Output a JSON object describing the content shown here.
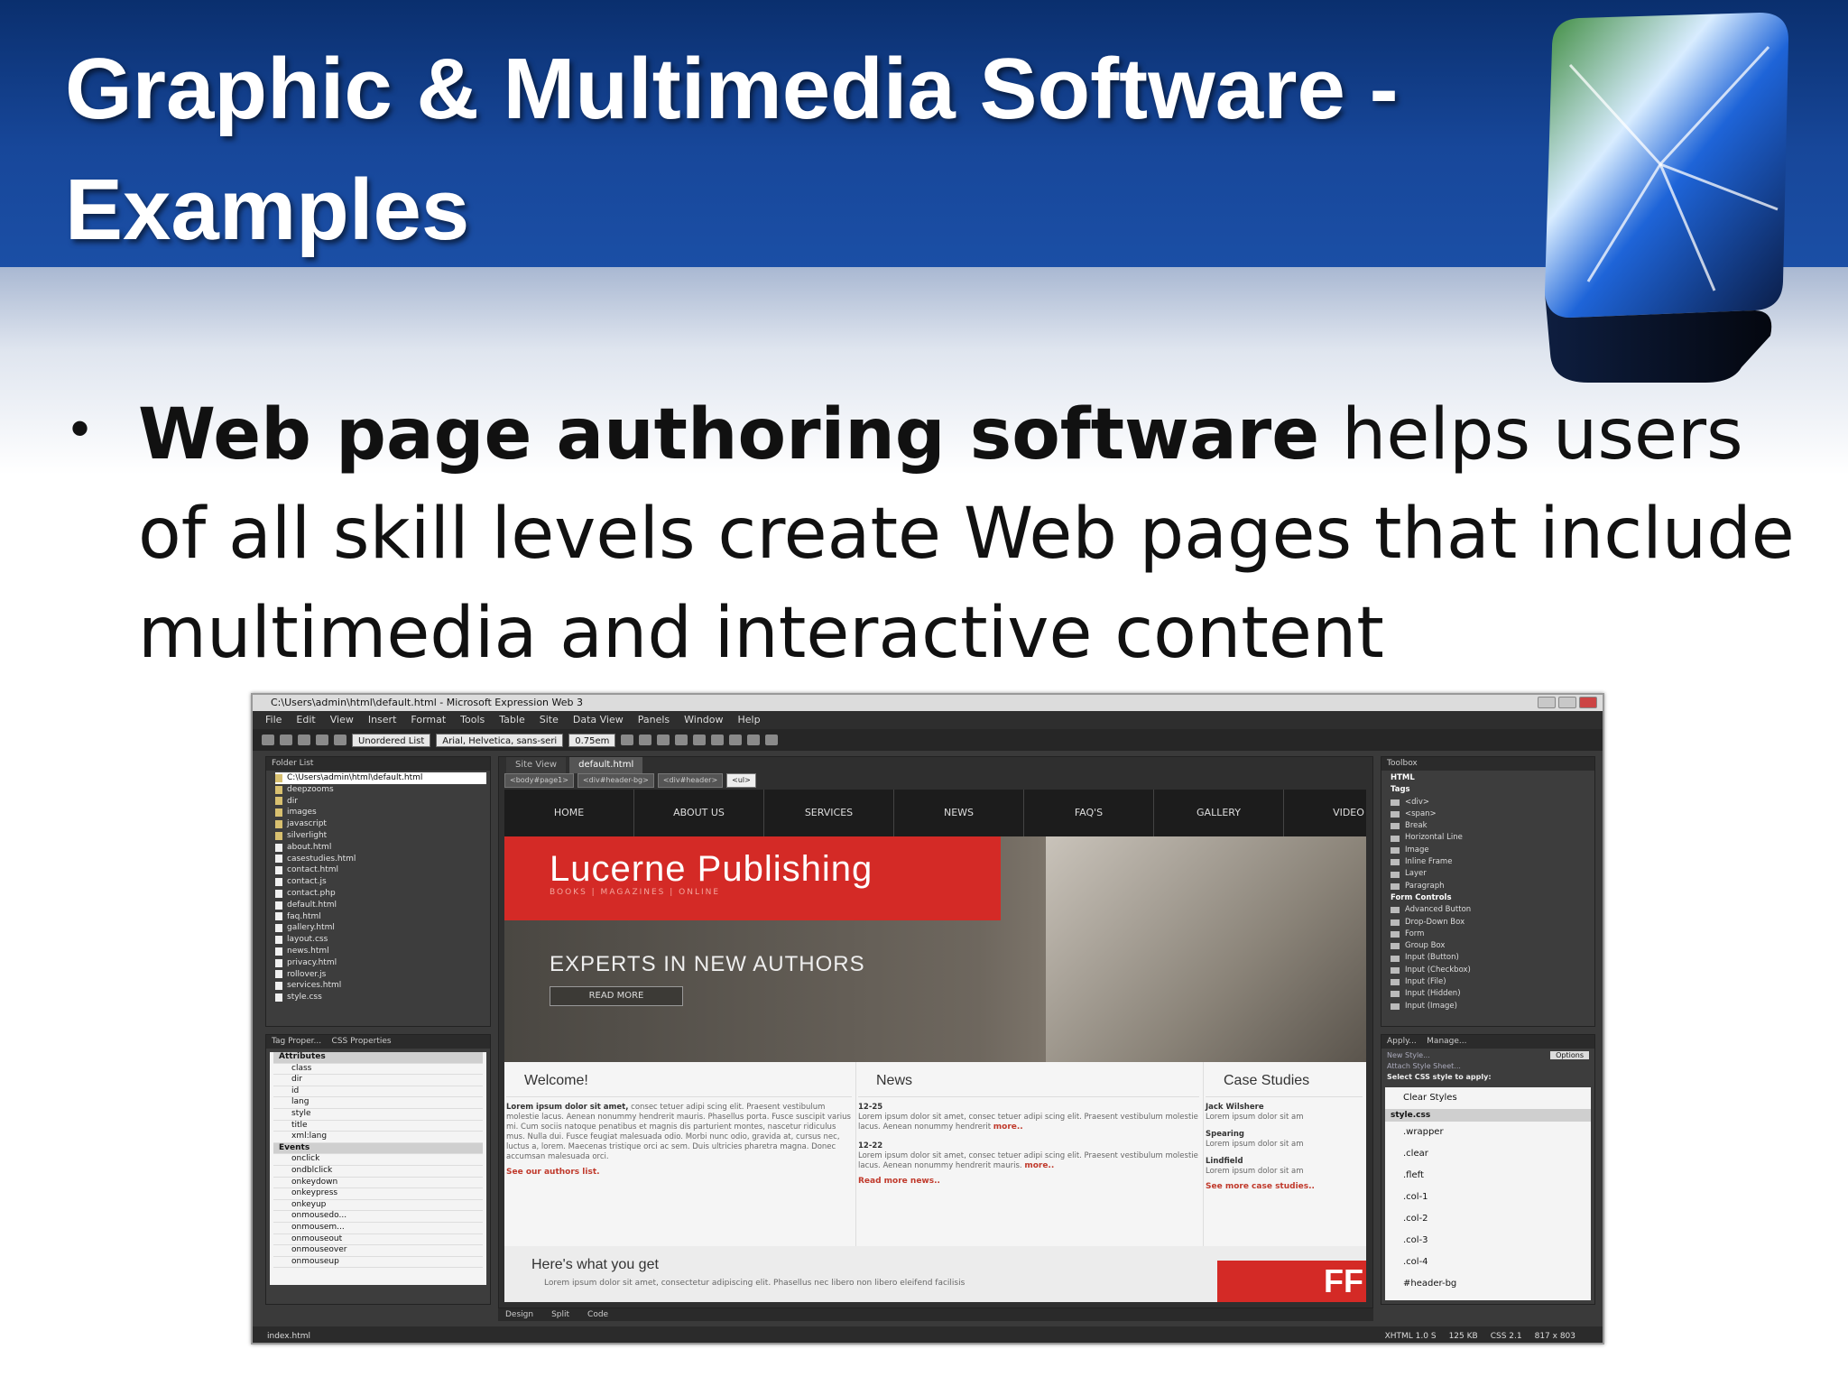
{
  "slide": {
    "title_line1": "Graphic & Multimedia Software -",
    "title_line2": "Examples",
    "bullet_bold": "Web page authoring software",
    "bullet_rest": " helps users of all skill levels create Web pages that include multimedia and interactive content"
  },
  "screenshot": {
    "window_title": "C:\\Users\\admin\\html\\default.html - Microsoft Expression Web 3",
    "menu": [
      "File",
      "Edit",
      "View",
      "Insert",
      "Format",
      "Tools",
      "Table",
      "Site",
      "Data View",
      "Panels",
      "Window",
      "Help"
    ],
    "toolbar": {
      "style_select": "Unordered List",
      "font_select": "Arial, Helvetica, sans-seri",
      "size_select": "0.75em"
    },
    "folder_panel": {
      "title": "Folder List",
      "items": [
        "C:\\Users\\admin\\html\\default.html",
        "deepzooms",
        "dir",
        "images",
        "javascript",
        "silverlight",
        "about.html",
        "casestudies.html",
        "contact.html",
        "contact.js",
        "contact.php",
        "default.html",
        "faq.html",
        "gallery.html",
        "layout.css",
        "news.html",
        "privacy.html",
        "rollover.js",
        "services.html",
        "style.css"
      ]
    },
    "tag_panel": {
      "title": "Tag Proper...",
      "title2": "CSS Properties",
      "items": [
        "Attributes",
        "class",
        "dir",
        "id",
        "lang",
        "style",
        "title",
        "xml:lang",
        "Events",
        "onclick",
        "ondblclick",
        "onkeydown",
        "onkeypress",
        "onkeyup",
        "onmousedo...",
        "onmousem...",
        "onmouseout",
        "onmouseover",
        "onmouseup"
      ]
    },
    "editor": {
      "tabs": [
        "Site View",
        "default.html"
      ],
      "breadcrumb": [
        "<body#page1>",
        "<div#header-bg>",
        "<div#header>",
        "<ul>"
      ],
      "nav": [
        "HOME",
        "ABOUT US",
        "SERVICES",
        "NEWS",
        "FAQ'S",
        "GALLERY",
        "VIDEO"
      ],
      "hero_title": "Lucerne Publishing",
      "hero_sub": "BOOKS | MAGAZINES | ONLINE",
      "hero_tagline": "EXPERTS IN NEW AUTHORS",
      "hero_button": "READ MORE",
      "col1_head": "Welcome!",
      "col1_lead": "Lorem ipsum dolor sit amet,",
      "col1_text": " consec tetuer adipi scing elit. Praesent vestibulum molestie lacus. Aenean nonummy hendrerit mauris. Phasellus porta. Fusce suscipit varius mi. Cum sociis natoque penatibus et magnis dis parturient montes, nascetur ridiculus mus. Nulla dui. Fusce feugiat malesuada odio. Morbi nunc odio, gravida at, cursus nec, luctus a, lorem. Maecenas tristique orci ac sem. Duis ultricies pharetra magna. Donec accumsan malesuada orci.",
      "col1_link": "See our authors list.",
      "col2_head": "News",
      "news1_date": "12-25",
      "news1_text": "Lorem ipsum dolor sit amet, consec tetuer adipi scing elit. Praesent vestibulum molestie lacus. Aenean nonummy hendrerit",
      "news1_more": "more..",
      "news2_date": "12-22",
      "news2_text": "Lorem ipsum dolor sit amet, consec tetuer adipi scing elit. Praesent vestibulum molestie lacus. Aenean nonummy hendrerit mauris.",
      "news2_more": "more..",
      "col2_link": "Read more news..",
      "col3_head": "Case Studies",
      "case1_name": "Jack Wilshere",
      "case1_text": "Lorem ipsum dolor sit am",
      "case2_name": "Spearing",
      "case2_text": "Lorem ipsum dolor sit am",
      "case3_name": "Lindfield",
      "case3_text": "Lorem ipsum dolor sit am",
      "col3_link": "See more case studies..",
      "what_head": "Here's what you get",
      "what_text": "Lorem ipsum dolor sit amet, consectetur adipiscing elit. Phasellus nec libero non libero eleifend facilisis",
      "ff_text": "FF",
      "views": [
        "Design",
        "Split",
        "Code"
      ]
    },
    "toolbox_panel": {
      "title": "Toolbox",
      "items": [
        "HTML",
        "Tags",
        "<div>",
        "<span>",
        "Break",
        "Horizontal Line",
        "Image",
        "Inline Frame",
        "Layer",
        "Paragraph",
        "Form Controls",
        "Advanced Button",
        "Drop-Down Box",
        "Form",
        "Group Box",
        "Input (Button)",
        "Input (Checkbox)",
        "Input (File)",
        "Input (Hidden)",
        "Input (Image)"
      ]
    },
    "apply_panel": {
      "title": "Apply...",
      "title2": "Manage...",
      "new_style": "New Style...",
      "options": "Options",
      "attach": "Attach Style Sheet...",
      "select_label": "Select CSS style to apply:",
      "items": [
        "Clear Styles",
        "style.css",
        ".wrapper",
        ".clear",
        ".fleft",
        ".col-1",
        ".col-2",
        ".col-3",
        ".col-4",
        "#header-bg"
      ]
    },
    "status": {
      "left": "index.html",
      "doctype": "XHTML 1.0 S",
      "size": "125 KB",
      "css": "CSS 2.1",
      "dims": "817 x 803"
    }
  }
}
